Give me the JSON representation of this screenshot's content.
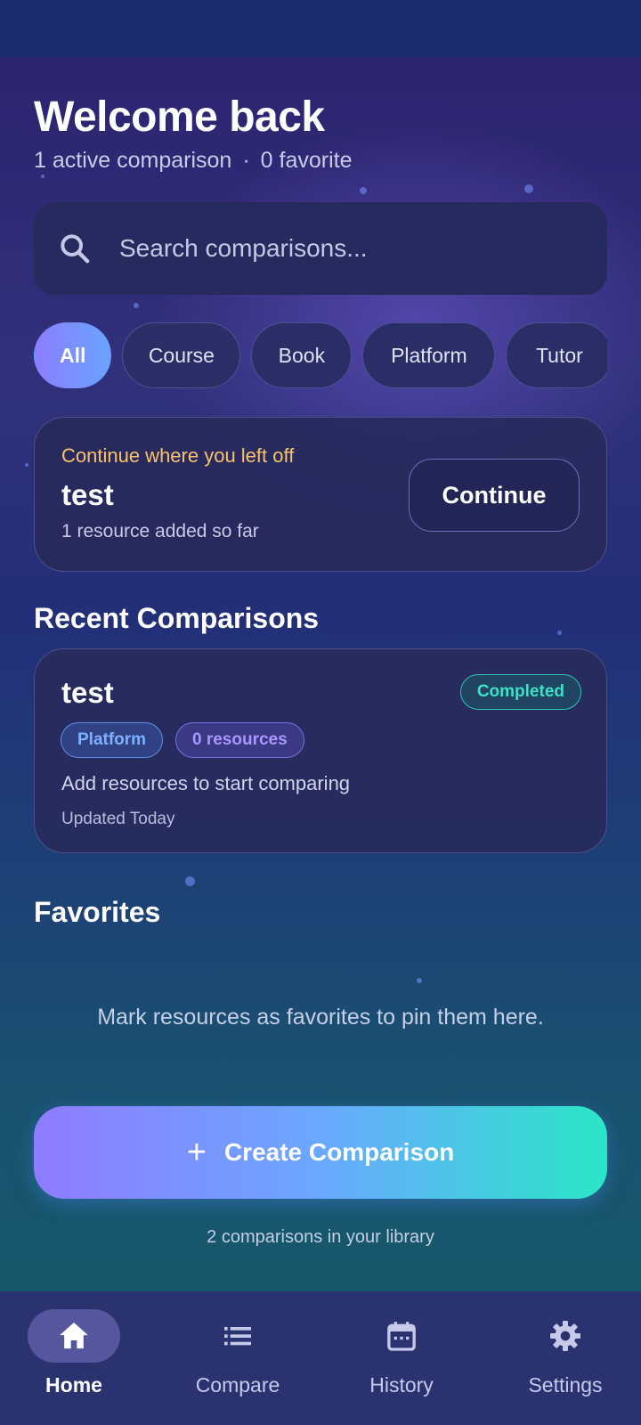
{
  "header": {
    "title": "Welcome back",
    "active_summary": "1 active comparison",
    "separator": "·",
    "favorite_summary": "0 favorite"
  },
  "search": {
    "placeholder": "Search comparisons...",
    "value": ""
  },
  "filters": {
    "selected": "All",
    "items": [
      "All",
      "Course",
      "Book",
      "Platform",
      "Tutor"
    ]
  },
  "continue_card": {
    "kicker": "Continue where you left off",
    "name": "test",
    "meta": "1 resource added so far",
    "button_label": "Continue"
  },
  "recent": {
    "section_title": "Recent Comparisons",
    "items": [
      {
        "name": "test",
        "status": "Completed",
        "category": "Platform",
        "resources": "0 resources",
        "description": "Add resources to start comparing",
        "updated": "Updated Today"
      }
    ]
  },
  "favorites": {
    "section_title": "Favorites",
    "empty_text": "Mark resources as favorites to pin them here."
  },
  "actions": {
    "create_label": "Create Comparison",
    "library_count": "2 comparisons in your library"
  },
  "bottom_nav": {
    "items": [
      {
        "label": "Home",
        "icon": "home-icon",
        "active": true
      },
      {
        "label": "Compare",
        "icon": "list-icon",
        "active": false
      },
      {
        "label": "History",
        "icon": "calendar-icon",
        "active": false
      },
      {
        "label": "Settings",
        "icon": "gear-icon",
        "active": false
      }
    ]
  },
  "colors": {
    "accent_purple": "#8c7dff",
    "accent_teal": "#2ae6c8",
    "kicker_orange": "#f7c26b",
    "completed_green": "#3be0c6"
  }
}
